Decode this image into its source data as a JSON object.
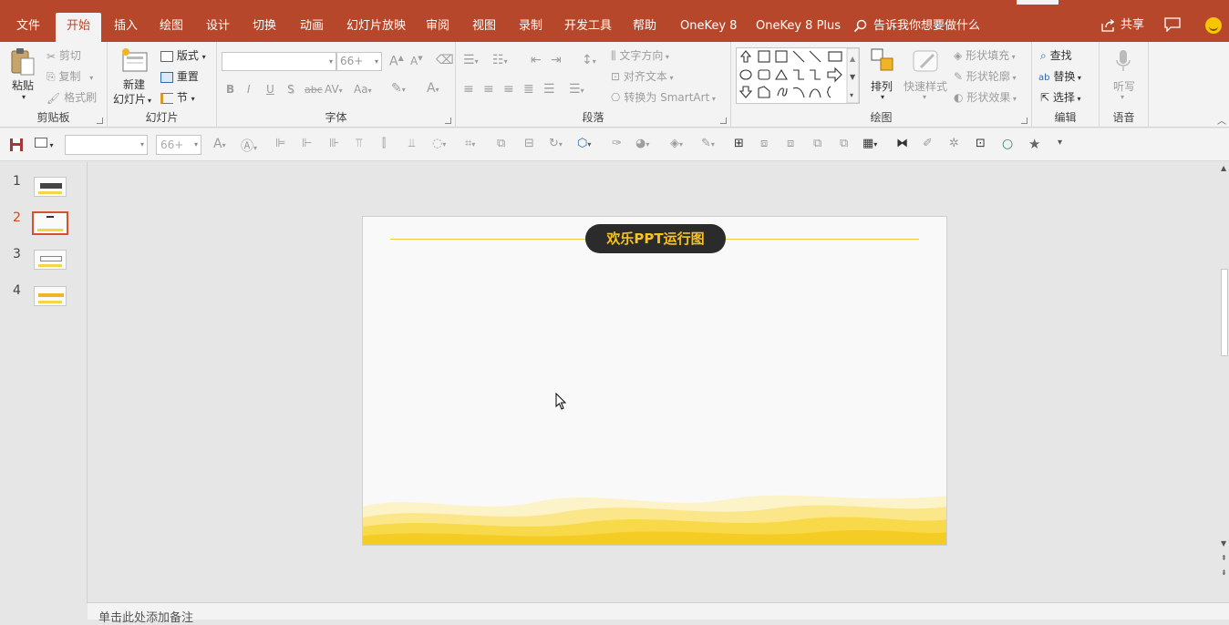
{
  "tabs": [
    {
      "label": "文件",
      "active": false
    },
    {
      "label": "开始",
      "active": true
    },
    {
      "label": "插入",
      "active": false
    },
    {
      "label": "绘图",
      "active": false
    },
    {
      "label": "设计",
      "active": false
    },
    {
      "label": "切换",
      "active": false
    },
    {
      "label": "动画",
      "active": false
    },
    {
      "label": "幻灯片放映",
      "active": false
    },
    {
      "label": "审阅",
      "active": false
    },
    {
      "label": "视图",
      "active": false
    },
    {
      "label": "录制",
      "active": false
    },
    {
      "label": "开发工具",
      "active": false
    },
    {
      "label": "帮助",
      "active": false
    },
    {
      "label": "OneKey 8",
      "active": false
    },
    {
      "label": "OneKey 8 Plus",
      "active": false
    }
  ],
  "tell_me": "告诉我你想要做什么",
  "share": "共享",
  "ribbon": {
    "clipboard": {
      "label": "剪贴板",
      "paste": "粘贴",
      "cut": "剪切",
      "copy": "复制",
      "format_painter": "格式刷"
    },
    "slides": {
      "label": "幻灯片",
      "new_slide_line1": "新建",
      "new_slide_line2": "幻灯片",
      "layout": "版式",
      "reset": "重置",
      "section": "节"
    },
    "font": {
      "label": "字体",
      "font_name": "",
      "font_size": "66+",
      "bold": "B",
      "italic": "I",
      "underline": "U",
      "shadow": "S",
      "strike": "abc",
      "spacing": "AV",
      "case": "Aa",
      "grow": "A",
      "shrink": "A"
    },
    "paragraph": {
      "label": "段落",
      "text_direction": "文字方向",
      "align_text": "对齐文本",
      "smartart": "转换为 SmartArt"
    },
    "drawing": {
      "label": "绘图",
      "arrange": "排列",
      "quick_styles": "快速样式",
      "shape_fill": "形状填充",
      "shape_outline": "形状轮廓",
      "shape_effects": "形状效果"
    },
    "editing": {
      "label": "编辑",
      "find": "查找",
      "replace": "替换",
      "select": "选择"
    },
    "voice": {
      "label": "语音",
      "dictate": "听写"
    }
  },
  "qat": {
    "font_name": "",
    "font_size": "66+"
  },
  "thumbnails": [
    {
      "number": "1",
      "active": false
    },
    {
      "number": "2",
      "active": true
    },
    {
      "number": "3",
      "active": false
    },
    {
      "number": "4",
      "active": false
    }
  ],
  "slide": {
    "title": "欢乐PPT运行图"
  },
  "notes_placeholder": "单击此处添加备注",
  "colors": {
    "accent": "#b7472a",
    "title_text": "#f6c31f",
    "pill_bg": "#2b2b2b",
    "wave": "#f5d547"
  }
}
